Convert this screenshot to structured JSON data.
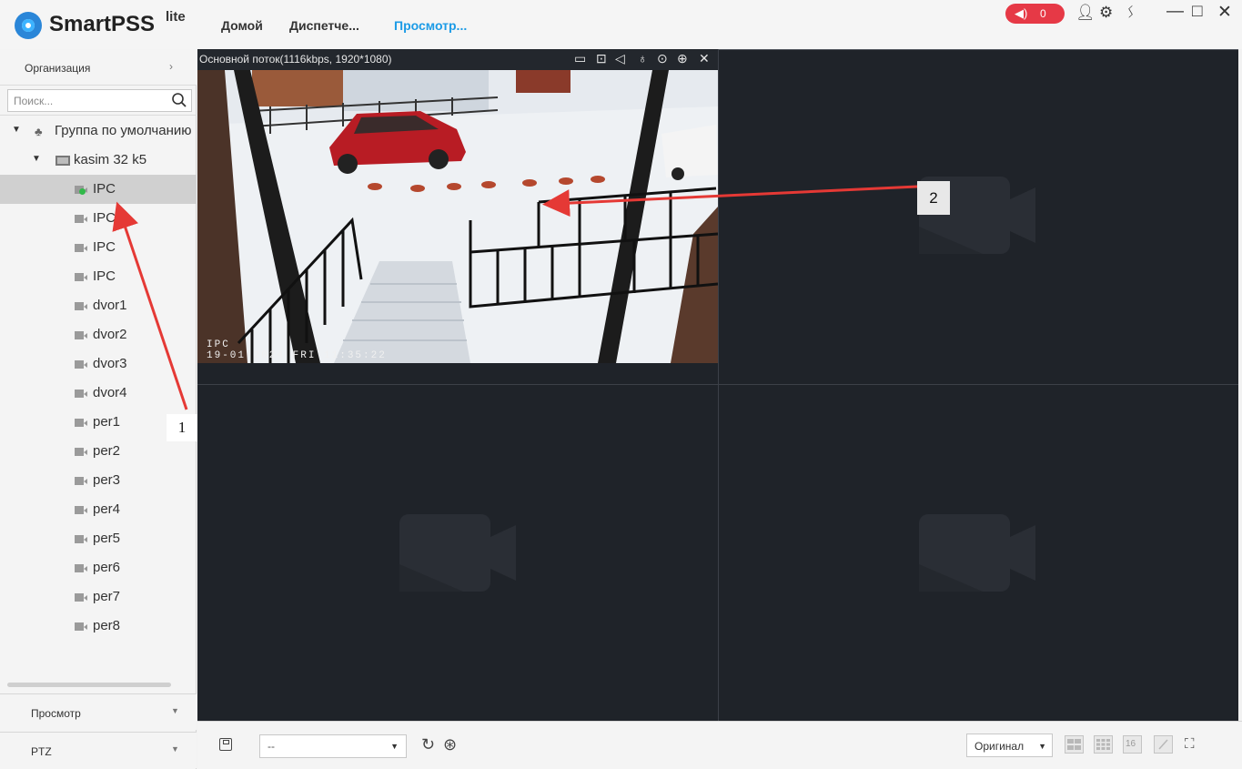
{
  "app": {
    "name": "SmartPSS",
    "suffix": "lite"
  },
  "nav": {
    "tabs": [
      {
        "label": "Домой"
      },
      {
        "label": "Диспетче..."
      },
      {
        "label": "Просмотр..."
      }
    ]
  },
  "alarm": {
    "count": "0",
    "color": "#e63946"
  },
  "left": {
    "org_label": "Организация",
    "search_placeholder": "Поиск...",
    "tree": {
      "group": "Группа по умолчанию",
      "device": "kasim 32 k5",
      "channels": [
        {
          "label": "IPC",
          "online": true,
          "selected": true
        },
        {
          "label": "IPC",
          "online": false
        },
        {
          "label": "IPC",
          "online": false
        },
        {
          "label": "IPC",
          "online": false
        },
        {
          "label": "dvor1",
          "online": false
        },
        {
          "label": "dvor2",
          "online": false
        },
        {
          "label": "dvor3",
          "online": false
        },
        {
          "label": "dvor4",
          "online": false
        },
        {
          "label": "per1",
          "online": false
        },
        {
          "label": "per2",
          "online": false
        },
        {
          "label": "per3",
          "online": false
        },
        {
          "label": "per4",
          "online": false
        },
        {
          "label": "per5",
          "online": false
        },
        {
          "label": "per6",
          "online": false
        },
        {
          "label": "per7",
          "online": false
        },
        {
          "label": "per8",
          "online": false
        }
      ]
    },
    "bottom_tabs": [
      {
        "label": "Просмотр"
      },
      {
        "label": "PTZ"
      }
    ]
  },
  "video": {
    "stream_info": "Основной поток(1116kbps, 1920*1080)",
    "controls": [
      "record-icon",
      "snapshot-icon",
      "audio-icon",
      "talk-icon",
      "playback-icon",
      "zoom-icon",
      "close-icon"
    ],
    "osd_name": "IPC",
    "osd_time": "19-01-2024 FRI 11:35:22"
  },
  "bottombar": {
    "view_select": "--",
    "ratio_select": "Оригинал",
    "layouts": [
      "",
      "",
      "16"
    ]
  },
  "annotations": [
    {
      "label": "1"
    },
    {
      "label": "2"
    }
  ],
  "colors": {
    "accent": "#1c9be6",
    "video_bg": "#1f2329",
    "arrow": "#e53935"
  }
}
